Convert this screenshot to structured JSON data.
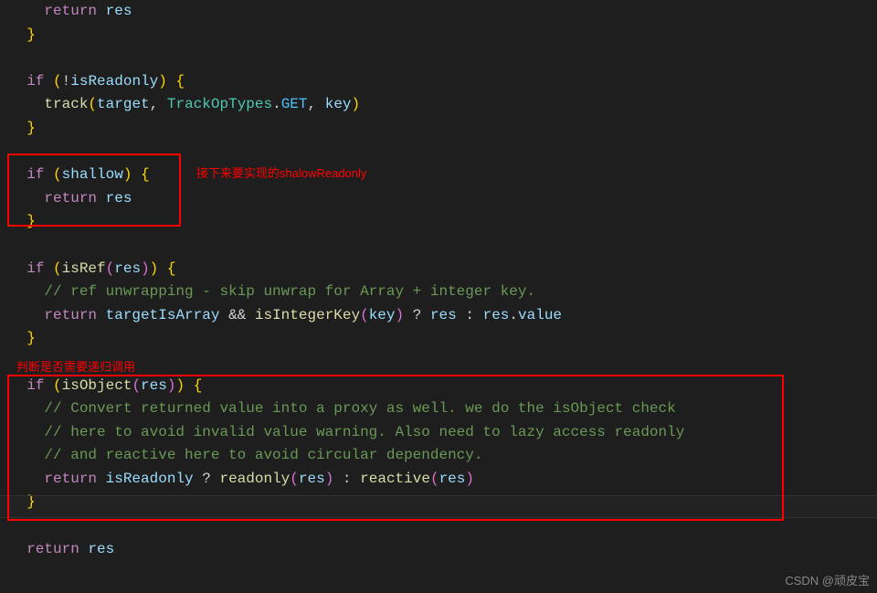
{
  "code": {
    "l1_return": "return",
    "l1_res": "res",
    "brace_close": "}",
    "l_if": "if",
    "l4_not": "!",
    "l4_isReadonly": "isReadonly",
    "brace_open": "{",
    "l5_track": "track",
    "l5_target": "target",
    "l5_TrackOpTypes": "TrackOpTypes",
    "l5_GET": "GET",
    "l5_key": "key",
    "l8_shallow": "shallow",
    "l9_return": "return",
    "l9_res": "res",
    "l12_isRef": "isRef",
    "l12_res": "res",
    "l13_comment": "// ref unwrapping - skip unwrap for Array + integer key.",
    "l14_return": "return",
    "l14_targetIsArray": "targetIsArray",
    "l14_and": "&&",
    "l14_isIntegerKey": "isIntegerKey",
    "l14_key": "key",
    "l14_q": "?",
    "l14_res1": "res",
    "l14_colon": ":",
    "l14_res2": "res",
    "l14_value": "value",
    "l17_isObject": "isObject",
    "l17_res": "res",
    "l18_comment": "// Convert returned value into a proxy as well. we do the isObject check",
    "l19_comment": "// here to avoid invalid value warning. Also need to lazy access readonly",
    "l20_comment": "// and reactive here to avoid circular dependency.",
    "l21_return": "return",
    "l21_isReadonly": "isReadonly",
    "l21_q": "?",
    "l21_readonly": "readonly",
    "l21_res1": "res",
    "l21_colon": ":",
    "l21_reactive": "reactive",
    "l21_res2": "res",
    "l24_return": "return",
    "l24_res": "res"
  },
  "annotations": {
    "a1": "接下来要实现的shalowReadonly",
    "a2": "判断是否需要递归调用"
  },
  "watermark": "CSDN @顽皮宝"
}
